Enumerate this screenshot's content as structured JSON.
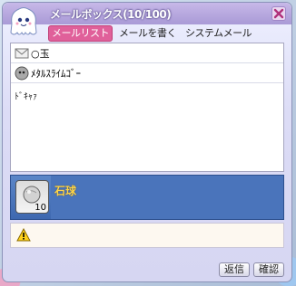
{
  "window": {
    "title": "メールボックス(10/100)"
  },
  "tabs": [
    {
      "label": "メールリスト",
      "active": true
    },
    {
      "label": "メールを書く",
      "active": false
    },
    {
      "label": "システムメール",
      "active": false
    }
  ],
  "mail": {
    "subject": "○玉",
    "sender": "ﾒﾀﾙｽﾗｲﾑｺﾞｰ",
    "body": "ﾄﾞｷｬｧ"
  },
  "attachment": {
    "name": "石球",
    "quantity": "10"
  },
  "buttons": {
    "reply": "返信",
    "confirm": "確認"
  },
  "colors": {
    "accent_tab": "#e0609a",
    "item_bar": "#3e68b0",
    "item_name": "#ffd54a"
  }
}
